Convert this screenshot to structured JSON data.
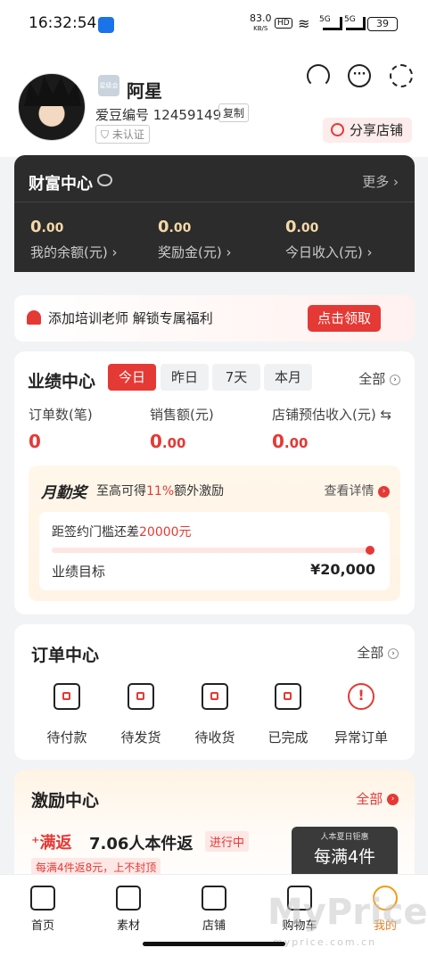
{
  "status_bar": {
    "time": "16:32:54",
    "speed": "83.0",
    "speed_unit": "KB/S",
    "hd": "HD",
    "net1": "5G",
    "net2": "5G",
    "battery": "39"
  },
  "profile": {
    "name": "阿星",
    "badge": "星级会员",
    "uid": "爱豆编号 12459149",
    "copy": "复制",
    "verify": "未认证",
    "share": "分享店铺"
  },
  "wealth": {
    "title": "财富中心",
    "more": "更多 ›",
    "items": [
      {
        "int": "0",
        "dec": ".00",
        "label": "我的余额(元) ›"
      },
      {
        "int": "0",
        "dec": ".00",
        "label": "奖励金(元) ›"
      },
      {
        "int": "0",
        "dec": ".00",
        "label": "今日收入(元) ›"
      }
    ]
  },
  "banner": {
    "text": "添加培训老师 解锁专属福利",
    "button": "点击领取"
  },
  "performance": {
    "title": "业绩中心",
    "tabs": [
      "今日",
      "昨日",
      "7天",
      "本月"
    ],
    "all": "全部",
    "metrics": [
      {
        "label": "订单数(笔)",
        "int": "0",
        "dec": ""
      },
      {
        "label": "销售额(元)",
        "int": "0",
        "dec": ".00"
      },
      {
        "label": "店铺预估收入(元) ⇆",
        "int": "0",
        "dec": ".00"
      }
    ],
    "monthly": {
      "logo": "月勤奖",
      "desc_pre": "至高可得",
      "desc_pct": "11%",
      "desc_post": "额外激励",
      "detail": "查看详情",
      "gap_pre": "距签约门槛还差",
      "gap_amount": "20000元",
      "target_label": "业绩目标",
      "target_value": "¥20,000"
    }
  },
  "orders": {
    "title": "订单中心",
    "all": "全部",
    "items": [
      {
        "label": "待付款",
        "icon": "wallet-icon"
      },
      {
        "label": "待发货",
        "icon": "package-icon"
      },
      {
        "label": "待收货",
        "icon": "truck-icon"
      },
      {
        "label": "已完成",
        "icon": "check-doc-icon"
      },
      {
        "label": "异常订单",
        "icon": "alert-icon"
      }
    ]
  },
  "incentive": {
    "title": "激励中心",
    "all": "全部",
    "tag": "⁺满返",
    "name": "7.06人本件返",
    "status": "进行中",
    "rule": "每满4件返8元，上不封顶",
    "promo_small": "人本夏日钜惠",
    "promo_big": "每满4件"
  },
  "tabbar": [
    {
      "label": "首页",
      "icon": "home-icon"
    },
    {
      "label": "素材",
      "icon": "image-icon"
    },
    {
      "label": "店铺",
      "icon": "store-icon"
    },
    {
      "label": "购物车",
      "icon": "cart-icon"
    },
    {
      "label": "我的",
      "icon": "profile-icon"
    }
  ],
  "watermark": {
    "big": "MyPrice",
    "small": "myprice.com.cn"
  },
  "colors": {
    "accent": "#e53935",
    "dark_card": "#2c2c2c",
    "gold": "#f5d9a8",
    "active_tab": "#e67e22"
  }
}
